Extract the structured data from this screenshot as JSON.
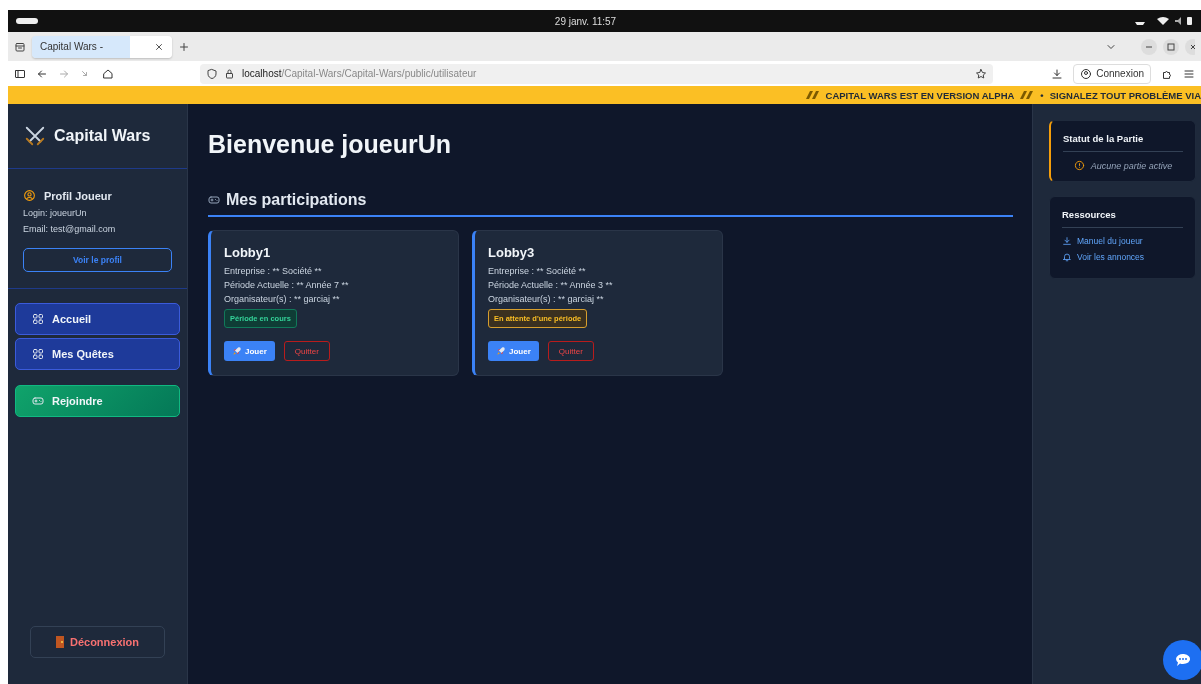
{
  "os_bar": {
    "clock": "29 janv.  11:57"
  },
  "browser": {
    "tabs": [
      {
        "title": "Capital Wars -",
        "selected": true
      }
    ],
    "url": {
      "host": "localhost",
      "path": "/Capital-Wars/Capital-Wars/public/utilisateur"
    },
    "account_button": "Connexion"
  },
  "banner": {
    "messages": [
      "CAPITAL WARS EST EN VERSION ALPHA",
      "•",
      "SIGNALEZ TOUT PROBLÈME VIA"
    ]
  },
  "sidebar": {
    "brand": "Capital Wars",
    "profile": {
      "title": "Profil Joueur",
      "login_label": "Login:",
      "login": "joueurUn",
      "email_label": "Email:",
      "email": "test@gmail.com",
      "button": "Voir le profil"
    },
    "nav": [
      {
        "label": "Accueil",
        "kind": "nav"
      },
      {
        "label": "Mes Quêtes",
        "kind": "nav"
      },
      {
        "label": "Rejoindre",
        "kind": "join"
      }
    ],
    "logout": "Déconnexion"
  },
  "main": {
    "title": "Bienvenue joueurUn",
    "section": "Mes participations",
    "cards": [
      {
        "name": "Lobby1",
        "lines": [
          "Entreprise : ** Société **",
          "Période Actuelle : ** Année 7 **",
          "Organisateur(s) : ** garciaj **"
        ],
        "status": {
          "label": "Période en cours",
          "kind": "active"
        },
        "play": "Jouer",
        "quit": "Quitter"
      },
      {
        "name": "Lobby3",
        "lines": [
          "Entreprise : ** Société **",
          "Période Actuelle : ** Année 3 **",
          "Organisateur(s) : ** garciaj **"
        ],
        "status": {
          "label": "En attente d'une période",
          "kind": "waiting"
        },
        "play": "Jouer",
        "quit": "Quitter"
      }
    ]
  },
  "right_panel": {
    "status_card": {
      "title": "Statut de la Partie",
      "message": "Aucune partie active"
    },
    "resources": {
      "title": "Ressources",
      "links": [
        {
          "label": "Manuel du joueur",
          "kind": "download"
        },
        {
          "label": "Voir les annonces",
          "kind": "bell"
        }
      ]
    }
  }
}
